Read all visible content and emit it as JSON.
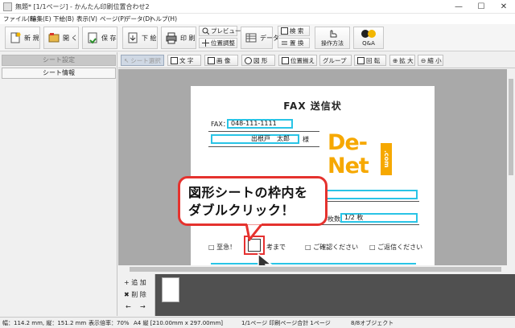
{
  "window": {
    "title": "無題* [1/1ページ] - かんたん印刷位置合わせ2",
    "minimize_glyph": "—",
    "maximize_glyph": "☐",
    "close_glyph": "✕"
  },
  "menu": [
    "ファイル(F)",
    "編集(E)",
    "下絵(B)",
    "表示(V)",
    "ページ(P)",
    "データ(D)",
    "ヘルプ(H)"
  ],
  "toolbar": {
    "new": "新 規",
    "open": "開 く",
    "save": "保 存",
    "underlay": "下 絵",
    "print": "印 刷",
    "preview": "プレビュー",
    "position_adjust": "位置調整",
    "data": "データ",
    "search": "検 索",
    "replace": "置 換",
    "howto": "操作方法",
    "qa": "Q&A"
  },
  "left_panel": {
    "sheet_settings": "シート設定",
    "sheet_info": "シート情報"
  },
  "tools": [
    "シート選択",
    "文 字",
    "画 像",
    "図 形",
    "位置揃え",
    "グループ",
    "回 転",
    "拡 大",
    "縮 小"
  ],
  "document": {
    "title": "FAX 送信状",
    "fax_label": "FAX：",
    "fax_number": "048-111-1111",
    "recipient": "出根戸　太郎",
    "honorific": "様",
    "pages_label": "枚数：",
    "pages_value": "1/2 枚",
    "checkbox_1": "□ 至急！",
    "deadline_text": "考まで",
    "checkbox_2": "□ ご確認ください",
    "checkbox_3": "□ ご返信ください",
    "logo_line1": "De-",
    "logo_line2": "Net",
    "logo_com": ".com"
  },
  "callout": {
    "line1": "図形シートの枠内を",
    "line2": "ダブルクリック！"
  },
  "bottom_panel": {
    "add": "+ 追 加",
    "delete": "✖ 削 除",
    "prev": "←",
    "next": "→"
  },
  "status": {
    "coords": "幅：114.2 mm, 縦：151.2 mm",
    "zoom": "表示倍率：70%",
    "paper": "A4 縦 [210.00mm x 297.00mm]",
    "pages": "1/1ページ  印刷ページ合計 1ページ",
    "objects": "8/8オブジェクト"
  },
  "colors": {
    "field_border": "#29c4e6",
    "callout_border": "#e5322e",
    "logo": "#f6a800"
  }
}
